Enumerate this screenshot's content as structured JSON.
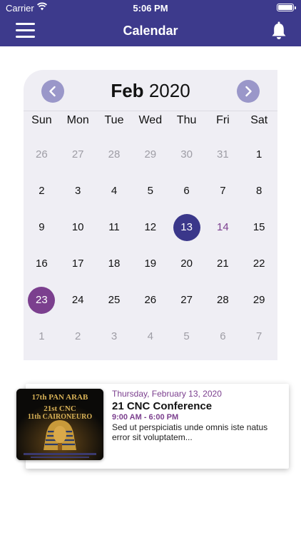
{
  "status_bar": {
    "carrier": "Carrier",
    "time": "5:06 PM"
  },
  "nav": {
    "title": "Calendar",
    "menu_icon": "hamburger-menu-icon",
    "bell_icon": "bell-icon"
  },
  "calendar": {
    "month": "Feb",
    "year": "2020",
    "weekdays": [
      "Sun",
      "Mon",
      "Tue",
      "Wed",
      "Thu",
      "Fri",
      "Sat"
    ],
    "weeks": [
      [
        {
          "d": "26",
          "muted": true
        },
        {
          "d": "27",
          "muted": true
        },
        {
          "d": "28",
          "muted": true
        },
        {
          "d": "29",
          "muted": true
        },
        {
          "d": "30",
          "muted": true
        },
        {
          "d": "31",
          "muted": true
        },
        {
          "d": "1"
        }
      ],
      [
        {
          "d": "2"
        },
        {
          "d": "3"
        },
        {
          "d": "4"
        },
        {
          "d": "5"
        },
        {
          "d": "6"
        },
        {
          "d": "7"
        },
        {
          "d": "8"
        }
      ],
      [
        {
          "d": "9"
        },
        {
          "d": "10"
        },
        {
          "d": "11"
        },
        {
          "d": "12"
        },
        {
          "d": "13",
          "state": "today"
        },
        {
          "d": "14",
          "state": "event"
        },
        {
          "d": "15"
        }
      ],
      [
        {
          "d": "16"
        },
        {
          "d": "17"
        },
        {
          "d": "18"
        },
        {
          "d": "19"
        },
        {
          "d": "20"
        },
        {
          "d": "21"
        },
        {
          "d": "22"
        }
      ],
      [
        {
          "d": "23",
          "state": "selected"
        },
        {
          "d": "24"
        },
        {
          "d": "25"
        },
        {
          "d": "26"
        },
        {
          "d": "27"
        },
        {
          "d": "28"
        },
        {
          "d": "29"
        }
      ],
      [
        {
          "d": "1",
          "muted": true
        },
        {
          "d": "2",
          "muted": true
        },
        {
          "d": "3",
          "muted": true
        },
        {
          "d": "4",
          "muted": true
        },
        {
          "d": "5",
          "muted": true
        },
        {
          "d": "6",
          "muted": true
        },
        {
          "d": "7",
          "muted": true
        }
      ]
    ]
  },
  "event": {
    "date": "Thursday, February 13, 2020",
    "title": "21 CNC Conference",
    "time": "9:00 AM - 6:00 PM",
    "description": "Sed ut perspiciatis unde omnis iste natus error sit voluptatem...",
    "poster": {
      "line1": "17th PAN ARAB",
      "line2": "21st CNC",
      "line3": "11th CAIRONEURO"
    }
  },
  "colors": {
    "header": "#3d3a8c",
    "today": "#3a378a",
    "accent": "#7b3f8e",
    "calendar_bg": "#efeef4",
    "arrow": "#9a97c9"
  }
}
